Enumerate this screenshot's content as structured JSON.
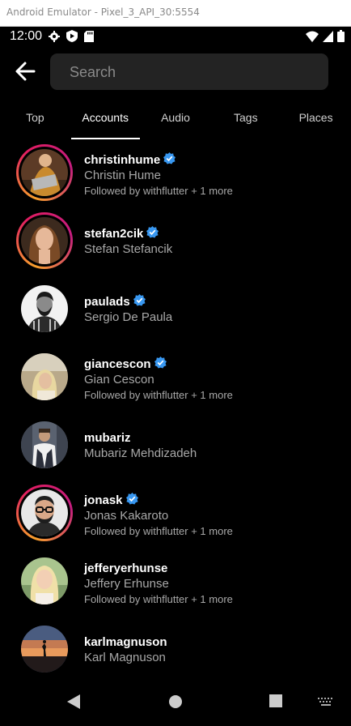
{
  "window": {
    "title": "Android Emulator - Pixel_3_API_30:5554"
  },
  "status_bar": {
    "time": "12:00"
  },
  "search": {
    "placeholder": "Search",
    "value": ""
  },
  "tabs": [
    {
      "label": "Top",
      "active": false
    },
    {
      "label": "Accounts",
      "active": true
    },
    {
      "label": "Audio",
      "active": false
    },
    {
      "label": "Tags",
      "active": false
    },
    {
      "label": "Places",
      "active": false
    }
  ],
  "accounts": [
    {
      "username": "christinhume",
      "name": "Christin Hume",
      "verified": true,
      "followed_by": "Followed by withflutter + 1 more",
      "story_ring": true,
      "avatar_icon": "person-with-laptop"
    },
    {
      "username": "stefan2cik",
      "name": "Stefan Stefancik",
      "verified": true,
      "followed_by": "",
      "story_ring": true,
      "avatar_icon": "woman-portrait"
    },
    {
      "username": "paulads",
      "name": "Sergio De Paula",
      "verified": true,
      "followed_by": "",
      "story_ring": false,
      "avatar_icon": "bw-man-portrait"
    },
    {
      "username": "giancescon",
      "name": "Gian Cescon",
      "verified": true,
      "followed_by": "Followed by withflutter + 1 more",
      "story_ring": false,
      "avatar_icon": "blonde-woman-outdoors"
    },
    {
      "username": "mubariz",
      "name": "Mubariz Mehdizadeh",
      "verified": false,
      "followed_by": "",
      "story_ring": false,
      "avatar_icon": "man-in-vest"
    },
    {
      "username": "jonask",
      "name": "Jonas Kakaroto",
      "verified": true,
      "followed_by": "Followed by withflutter + 1 more",
      "story_ring": true,
      "avatar_icon": "man-with-glasses"
    },
    {
      "username": "jefferyerhunse",
      "name": "Jeffery Erhunse",
      "verified": false,
      "followed_by": "Followed by withflutter + 1 more",
      "story_ring": false,
      "avatar_icon": "blonde-woman-portrait"
    },
    {
      "username": "karlmagnuson",
      "name": "Karl Magnuson",
      "verified": false,
      "followed_by": "",
      "story_ring": false,
      "avatar_icon": "sunset-silhouette"
    }
  ],
  "colors": {
    "verified": "#3897f0",
    "ring_start": "#f7a02c",
    "ring_end": "#e11d61",
    "background": "#000000"
  }
}
